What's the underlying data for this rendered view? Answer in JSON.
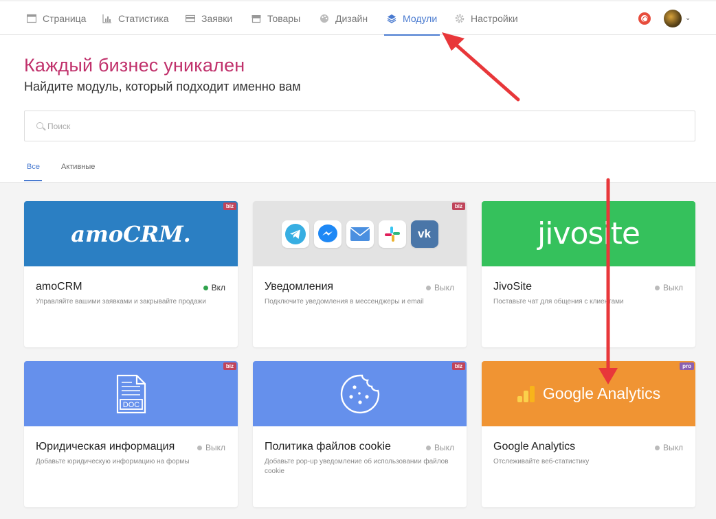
{
  "nav": {
    "items": [
      {
        "label": "Страница",
        "icon": "page-icon"
      },
      {
        "label": "Статистика",
        "icon": "chart-icon"
      },
      {
        "label": "Заявки",
        "icon": "inbox-icon"
      },
      {
        "label": "Товары",
        "icon": "store-icon"
      },
      {
        "label": "Дизайн",
        "icon": "palette-icon"
      },
      {
        "label": "Модули",
        "icon": "layers-icon",
        "active": true
      },
      {
        "label": "Настройки",
        "icon": "gear-icon"
      }
    ]
  },
  "hero": {
    "title": "Каждый бизнес уникален",
    "subtitle": "Найдите модуль, который подходит именно вам"
  },
  "search": {
    "placeholder": "Поиск",
    "value": ""
  },
  "tabs": [
    {
      "label": "Все",
      "active": true
    },
    {
      "label": "Активные",
      "active": false
    }
  ],
  "colors": {
    "accent": "#4a7bd0",
    "title": "#c0306b",
    "amocrm": "#2b7fc3",
    "notifications": "#e3e3e3",
    "jivosite": "#35c15c",
    "legal": "#6590ec",
    "cookie": "#6590ec",
    "ga": "#f09433"
  },
  "cards": [
    {
      "title": "amoCRM",
      "desc": "Управляйте вашими заявками и закрывайте продажи",
      "status": "Вкл",
      "on": true,
      "tag": "biz",
      "logo": "amoCRM."
    },
    {
      "title": "Уведомления",
      "desc": "Подключите уведомления в мессенджеры и email",
      "status": "Выкл",
      "on": false,
      "tag": "biz"
    },
    {
      "title": "JivoSite",
      "desc": "Поставьте чат для общения с клиентами",
      "status": "Выкл",
      "on": false,
      "tag": "",
      "logo": "jivosite"
    },
    {
      "title": "Юридическая информация",
      "desc": "Добавьте юридическую информацию на формы",
      "status": "Выкл",
      "on": false,
      "tag": "biz",
      "logo": "DOC"
    },
    {
      "title": "Политика файлов cookie",
      "desc": "Добавьте pop-up уведомление об использовании файлов cookie",
      "status": "Выкл",
      "on": false,
      "tag": "biz"
    },
    {
      "title": "Google Analytics",
      "desc": "Отслеживайте веб-статистику",
      "status": "Выкл",
      "on": false,
      "tag": "pro",
      "logo": "Google Analytics"
    }
  ]
}
